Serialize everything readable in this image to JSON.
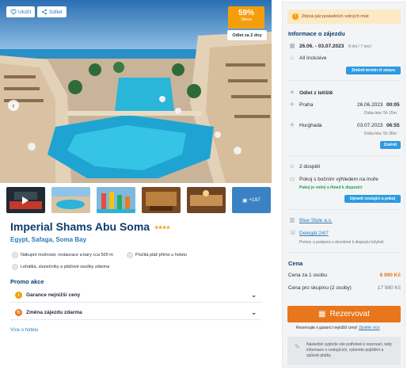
{
  "hero": {
    "save_label": "Uložit",
    "share_label": "Sdílet",
    "discount_percent": "59%",
    "discount_label": "Sleva",
    "departs_label": "Odlet za 2 dny"
  },
  "gallery": {
    "more_label": "+197"
  },
  "hotel": {
    "name": "Imperial Shams Abu Soma",
    "stars": "★★★★",
    "location": "Egypt, Safaga, Soma Bay",
    "features": [
      "Nákupní možnosti, restaurace a bary cca 500 m",
      "Písčitá pláž přímo u hotelu",
      "Lehátka, slunečníky a plážové osušky zdarma"
    ]
  },
  "promo": {
    "title": "Promo akce",
    "items": [
      "Garance nejnižší ceny",
      "Změna zájezdu zdarma"
    ],
    "more_link": "Více o hotelu"
  },
  "panel": {
    "alert": "Zbývá pár posledních volných míst",
    "trip_title": "Informace o zájezdu",
    "dates": "26.06. - 03.07.2023",
    "duration": "8 dní / 7 nocí",
    "board": "All Inclusive",
    "change_dates_button": "Změnit termín či stravu",
    "flight_title": "Odlet z letiště",
    "out_from": "Praha",
    "out_date": "26.06.2023",
    "out_time": "00:05",
    "out_duration": "Doba letu: 5h 15m",
    "ret_from": "Hurghada",
    "ret_date": "03.07.2023",
    "ret_time": "06:55",
    "ret_duration": "Doba letu: 5h 35m",
    "change_flight_button": "Změnit",
    "persons": "2 dospělí",
    "room": "Pokoj s bočním výhledem na moře",
    "room_note": "Pokoj je volný a ihned k dispozici",
    "edit_room_button": "Upravit cestující a pokoj",
    "operator": "Blue Style a.s.",
    "delegate": "Delegát 24/7",
    "delegate_note": "Pomoc a podpora o dovolené k dispozici kdykoli",
    "price_title": "Cena",
    "price_per_person_label": "Cena za 1 osobu",
    "price_per_person": "8 990 Kč",
    "price_group_label": "Cena pro skupinu (2 osoby)",
    "price_group": "17 980 Kč",
    "reserve_button": "Rezervovat",
    "guarantee_text": "Rezervujte s garancí nejnižší ceny!",
    "guarantee_link": "Zjistěte více",
    "note": "Následně vyplníte vše potřebné k rezervaci, tedy informace o cestujících, vyberete pojištění a způsob platby"
  },
  "colors": {
    "accent": "#2c9be2",
    "brand": "#0b3d6b",
    "cta": "#e8761c",
    "discount": "#f59e0b"
  },
  "icons": [
    "heart-icon",
    "share-icon",
    "chevron-left-icon",
    "play-icon",
    "gallery-icon",
    "calendar-icon",
    "food-icon",
    "plane-icon",
    "users-icon",
    "bed-icon",
    "building-icon",
    "headset-icon",
    "pin-icon",
    "chevron-down-icon",
    "info-icon"
  ]
}
